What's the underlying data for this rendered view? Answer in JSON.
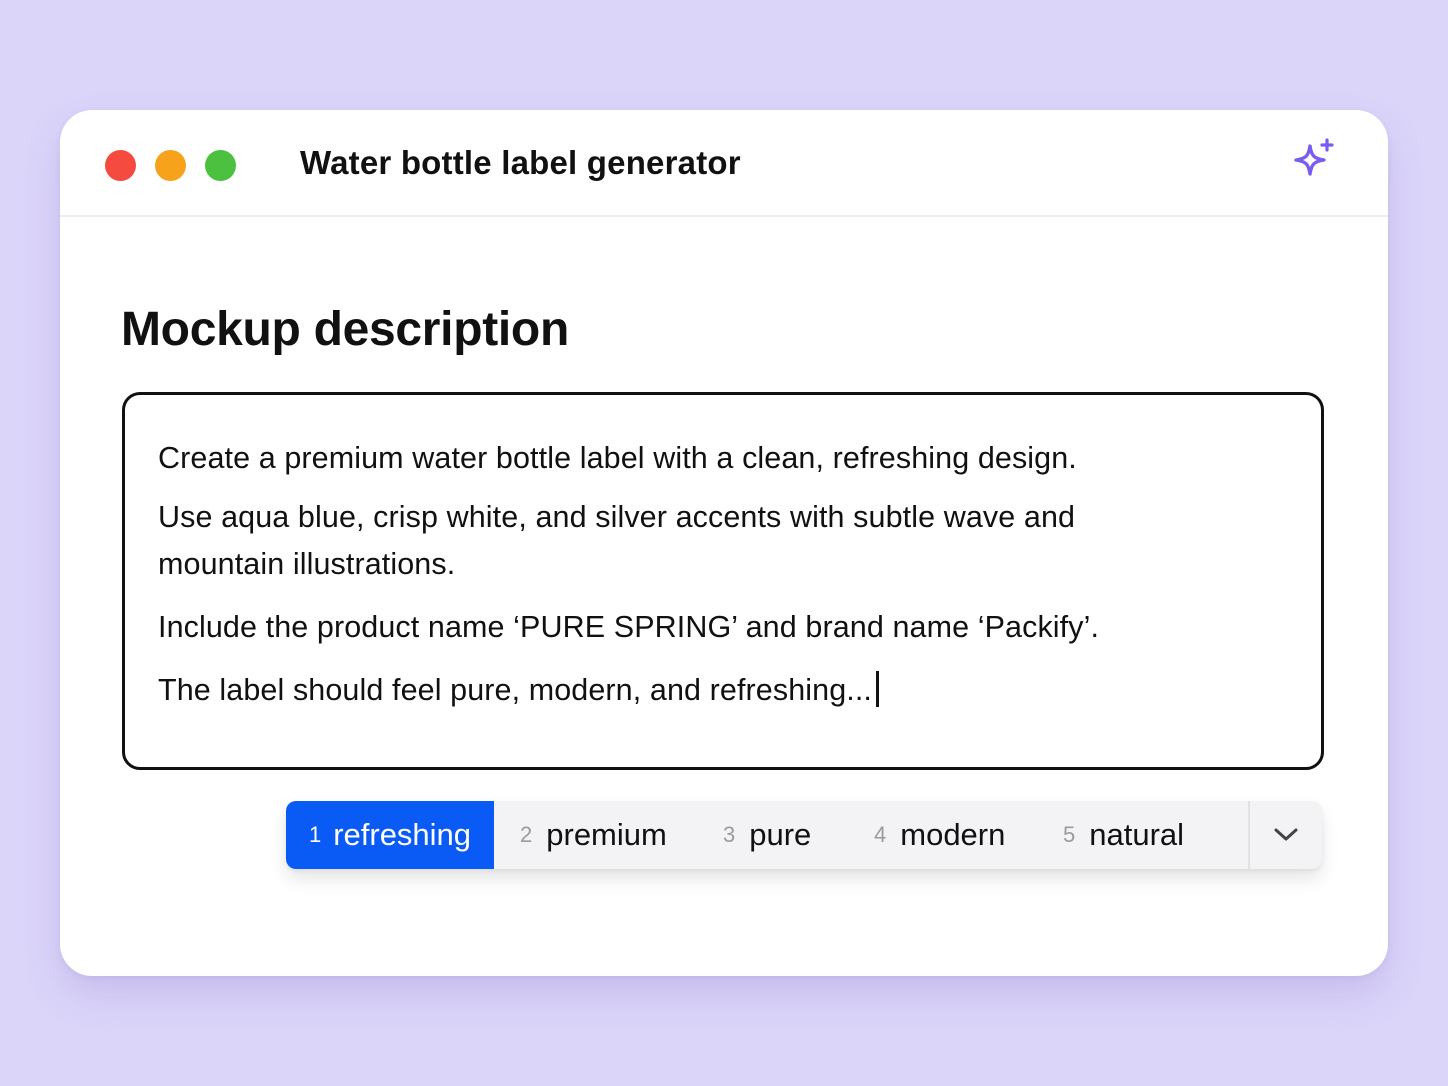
{
  "window": {
    "title": "Water bottle label generator",
    "controls": [
      "close-icon",
      "minimize-icon",
      "maximize-icon"
    ],
    "action_icon": "sparkle-icon"
  },
  "main": {
    "heading": "Mockup description",
    "description_lines": [
      "Create a premium water bottle label with a clean, refreshing design.",
      "Use aqua blue, crisp white, and silver accents with subtle wave and",
      "mountain illustrations.",
      "Include the product name ‘PURE SPRING’ and brand name ‘Packify’.",
      "The label should feel pure, modern, and refreshing..."
    ]
  },
  "suggestions": {
    "items": [
      {
        "num": "1",
        "word": "refreshing",
        "selected": true
      },
      {
        "num": "2",
        "word": "premium",
        "selected": false
      },
      {
        "num": "3",
        "word": "pure",
        "selected": false
      },
      {
        "num": "4",
        "word": "modern",
        "selected": false
      },
      {
        "num": "5",
        "word": "natural",
        "selected": false
      }
    ],
    "expand_icon": "chevron-down-icon"
  },
  "colors": {
    "background": "#dcd5fa",
    "accent": "#0a5af5",
    "sparkle": "#7b5cf0",
    "close": "#f54a3f",
    "minimize": "#f7a21b",
    "maximize": "#4cc03f"
  }
}
